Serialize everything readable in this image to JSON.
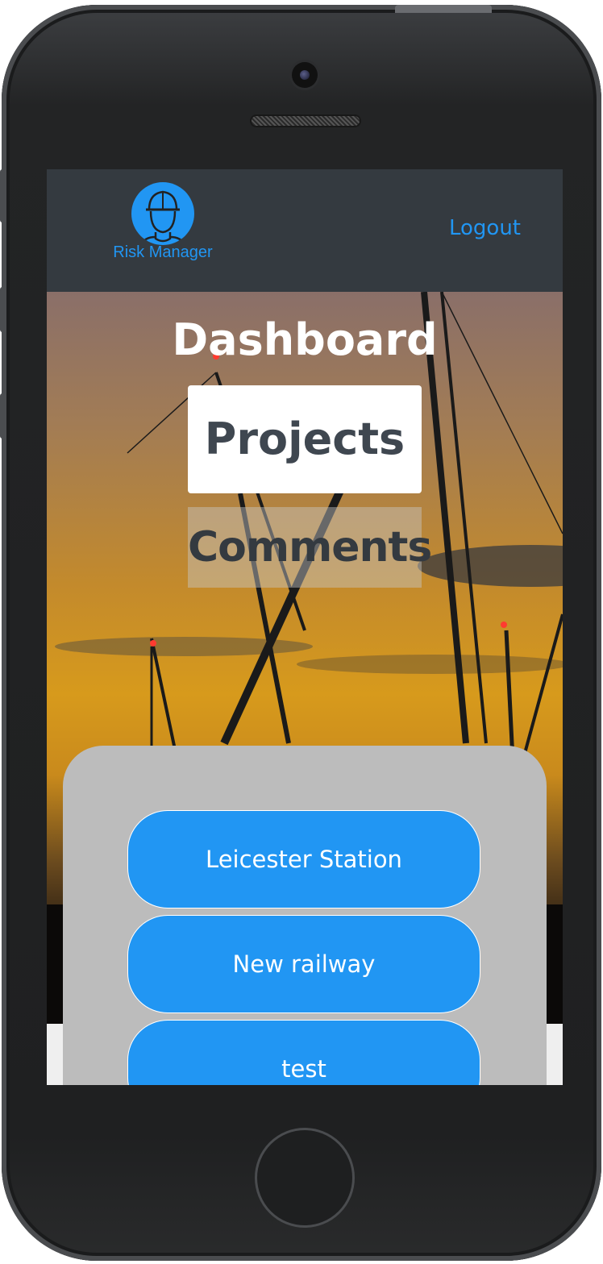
{
  "app": {
    "logo_text": "Risk Manager"
  },
  "navbar": {
    "logout_label": "Logout"
  },
  "main": {
    "title": "Dashboard",
    "tabs": [
      {
        "label": "Projects",
        "active": true
      },
      {
        "label": "Comments",
        "active": false
      }
    ]
  },
  "projects": [
    {
      "label": "Leicester Station"
    },
    {
      "label": "New railway"
    },
    {
      "label": "test"
    }
  ],
  "colors": {
    "accent": "#2196f3",
    "navbar": "#343a40",
    "panel": "#bcbcbc"
  },
  "icons": {
    "logo": "worker-helmet-icon"
  }
}
